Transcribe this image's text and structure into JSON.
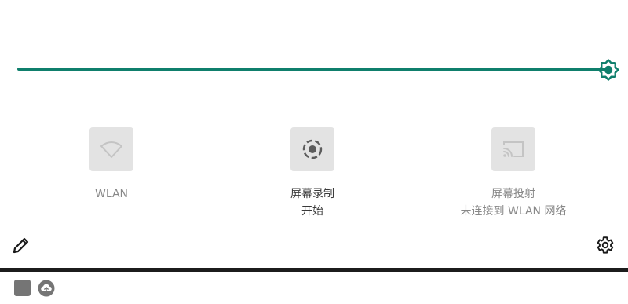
{
  "colors": {
    "accent": "#0f7f6c",
    "tile_bg": "#e3e3e3",
    "tile_inactive_icon": "#c4c4c4",
    "tile_active_icon": "#5c5c5c",
    "text_inactive": "#888888",
    "text_active": "#3a3a3a",
    "notif_icon": "#757575"
  },
  "brightness": {
    "level": 1.0,
    "icon": "brightness-icon"
  },
  "tiles": [
    {
      "label": "WLAN",
      "sub": "",
      "icon": "wifi-icon",
      "active": false
    },
    {
      "label": "屏幕录制",
      "sub": "开始",
      "icon": "screen-record-icon",
      "active": true
    },
    {
      "label": "屏幕投射",
      "sub": "未连接到 WLAN 网络",
      "icon": "cast-icon",
      "active": false
    }
  ],
  "footer": {
    "edit_icon": "pencil-icon",
    "settings_icon": "gear-icon"
  },
  "notifications": {
    "icons": [
      "square-app-icon",
      "cloud-upload-icon"
    ]
  }
}
